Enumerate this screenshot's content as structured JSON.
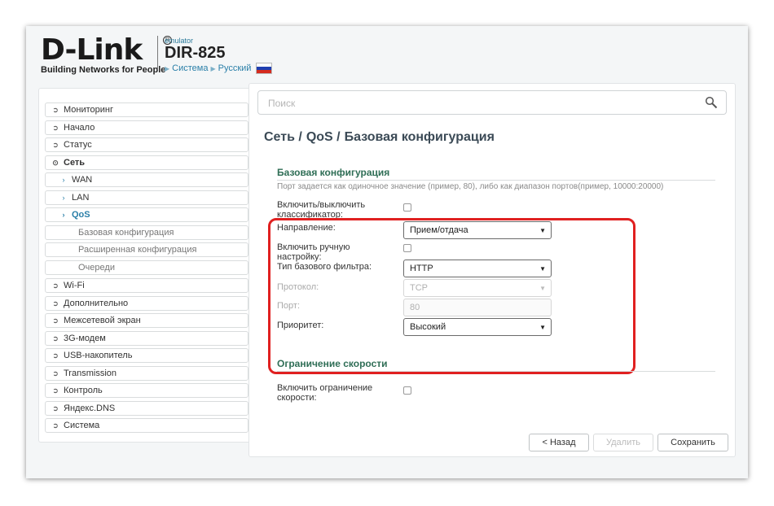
{
  "header": {
    "brand": "D-Link",
    "reg_mark": "R",
    "tagline": "Building Networks for People",
    "emulator_label": "emulator",
    "model": "DIR-825",
    "crumb_system": "Система",
    "crumb_language": "Русский",
    "flag_colors": [
      "#ffffff",
      "#1f3fb0",
      "#d52b1e"
    ]
  },
  "sidebar": {
    "items": [
      {
        "label": "Мониторинг",
        "icon": "chevron-right-circle-icon"
      },
      {
        "label": "Начало",
        "icon": "chevron-right-circle-icon"
      },
      {
        "label": "Статус",
        "icon": "chevron-right-circle-icon"
      },
      {
        "label": "Сеть",
        "icon": "chevron-down-circle-icon"
      },
      {
        "label": "WAN",
        "icon": "chevron-right-icon"
      },
      {
        "label": "LAN",
        "icon": "chevron-right-icon"
      },
      {
        "label": "QoS",
        "icon": "chevron-right-icon"
      },
      {
        "label": "Базовая конфигурация"
      },
      {
        "label": "Расширенная конфигурация"
      },
      {
        "label": "Очереди"
      },
      {
        "label": "Wi-Fi",
        "icon": "chevron-right-circle-icon"
      },
      {
        "label": "Дополнительно",
        "icon": "chevron-right-circle-icon"
      },
      {
        "label": "Межсетевой экран",
        "icon": "chevron-right-circle-icon"
      },
      {
        "label": "3G-модем",
        "icon": "chevron-right-circle-icon"
      },
      {
        "label": "USB-накопитель",
        "icon": "chevron-right-circle-icon"
      },
      {
        "label": "Transmission",
        "icon": "chevron-right-circle-icon"
      },
      {
        "label": "Контроль",
        "icon": "chevron-right-circle-icon"
      },
      {
        "label": "Яндекс.DNS",
        "icon": "chevron-right-circle-icon"
      },
      {
        "label": "Система",
        "icon": "chevron-right-circle-icon"
      }
    ]
  },
  "search": {
    "placeholder": "Поиск",
    "value": ""
  },
  "breadcrumb": {
    "part1": "Сеть /",
    "part2": "QoS /",
    "part3": "Базовая конфигурация"
  },
  "basic": {
    "title": "Базовая конфигурация",
    "hint": "Порт задается как одиночное значение (пример, 80), либо как диапазон портов(пример, 10000:20000)",
    "classifier_label": "Включить/выключить классификатор:",
    "classifier_checked": false,
    "direction_label": "Направление:",
    "direction_value": "Прием/отдача",
    "manual_label": "Включить ручную настройку:",
    "manual_checked": false,
    "filter_label": "Тип базового фильтра:",
    "filter_value": "HTTP",
    "protocol_label": "Протокол:",
    "protocol_value": "TCP",
    "port_label": "Порт:",
    "port_value": "80",
    "priority_label": "Приоритет:",
    "priority_value": "Высокий"
  },
  "speed": {
    "title": "Ограничение скорости",
    "limit_label": "Включить ограничение скорости:",
    "limit_checked": false
  },
  "buttons": {
    "back": "< Назад",
    "delete": "Удалить",
    "save": "Сохранить"
  },
  "colors": {
    "accent": "#2a7fa8",
    "section_title": "#2f6e56",
    "highlight": "#e02020"
  }
}
